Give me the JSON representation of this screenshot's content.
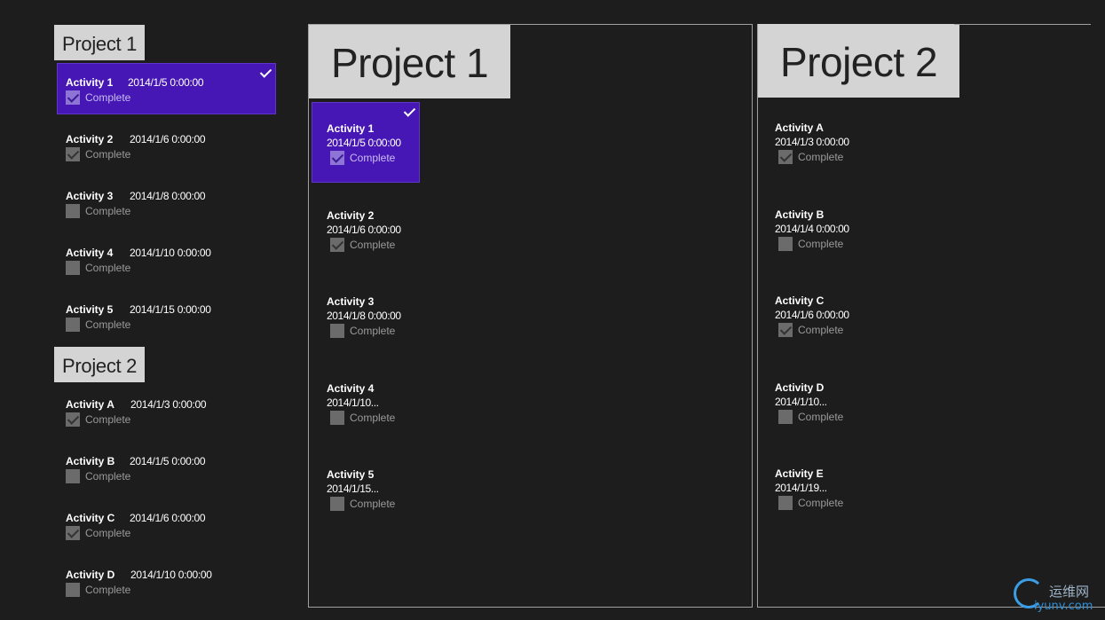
{
  "left_list": {
    "groups": [
      {
        "header": "Project 1",
        "items": [
          {
            "name": "Activity 1",
            "date": "2014/1/5 0:00:00",
            "complete_label": "Complete",
            "checked": true,
            "selected": true
          },
          {
            "name": "Activity 2",
            "date": "2014/1/6 0:00:00",
            "complete_label": "Complete",
            "checked": true,
            "selected": false
          },
          {
            "name": "Activity 3",
            "date": "2014/1/8 0:00:00",
            "complete_label": "Complete",
            "checked": false,
            "selected": false
          },
          {
            "name": "Activity 4",
            "date": "2014/1/10 0:00:00",
            "complete_label": "Complete",
            "checked": false,
            "selected": false
          },
          {
            "name": "Activity 5",
            "date": "2014/1/15 0:00:00",
            "complete_label": "Complete",
            "checked": false,
            "selected": false
          }
        ]
      },
      {
        "header": "Project 2",
        "items": [
          {
            "name": "Activity A",
            "date": "2014/1/3 0:00:00",
            "complete_label": "Complete",
            "checked": true,
            "selected": false
          },
          {
            "name": "Activity B",
            "date": "2014/1/5 0:00:00",
            "complete_label": "Complete",
            "checked": false,
            "selected": false
          },
          {
            "name": "Activity C",
            "date": "2014/1/6 0:00:00",
            "complete_label": "Complete",
            "checked": true,
            "selected": false
          },
          {
            "name": "Activity D",
            "date": "2014/1/10 0:00:00",
            "complete_label": "Complete",
            "checked": false,
            "selected": false
          }
        ]
      }
    ]
  },
  "panels": [
    {
      "header": "Project 1",
      "items": [
        {
          "name": "Activity 1",
          "date": "2014/1/5 0:00:00",
          "complete_label": "Complete",
          "checked": true,
          "selected": true
        },
        {
          "name": "Activity 2",
          "date": "2014/1/6 0:00:00",
          "complete_label": "Complete",
          "checked": true,
          "selected": false
        },
        {
          "name": "Activity 3",
          "date": "2014/1/8 0:00:00",
          "complete_label": "Complete",
          "checked": false,
          "selected": false
        },
        {
          "name": "Activity 4",
          "date": "2014/1/10...",
          "complete_label": "Complete",
          "checked": false,
          "selected": false
        },
        {
          "name": "Activity 5",
          "date": "2014/1/15...",
          "complete_label": "Complete",
          "checked": false,
          "selected": false
        }
      ]
    },
    {
      "header": "Project 2",
      "items": [
        {
          "name": "Activity A",
          "date": "2014/1/3 0:00:00",
          "complete_label": "Complete",
          "checked": true,
          "selected": false
        },
        {
          "name": "Activity B",
          "date": "2014/1/4 0:00:00",
          "complete_label": "Complete",
          "checked": false,
          "selected": false
        },
        {
          "name": "Activity C",
          "date": "2014/1/6 0:00:00",
          "complete_label": "Complete",
          "checked": true,
          "selected": false
        },
        {
          "name": "Activity D",
          "date": "2014/1/10...",
          "complete_label": "Complete",
          "checked": false,
          "selected": false
        },
        {
          "name": "Activity E",
          "date": "2014/1/19...",
          "complete_label": "Complete",
          "checked": false,
          "selected": false
        }
      ]
    }
  ],
  "watermark": {
    "cn": "运维网",
    "en": "iyunv.com"
  },
  "colors": {
    "background": "#1d1d1d",
    "accent": "#4617b4",
    "header_bg": "#d4d4d4",
    "border": "#a0a0a0"
  }
}
